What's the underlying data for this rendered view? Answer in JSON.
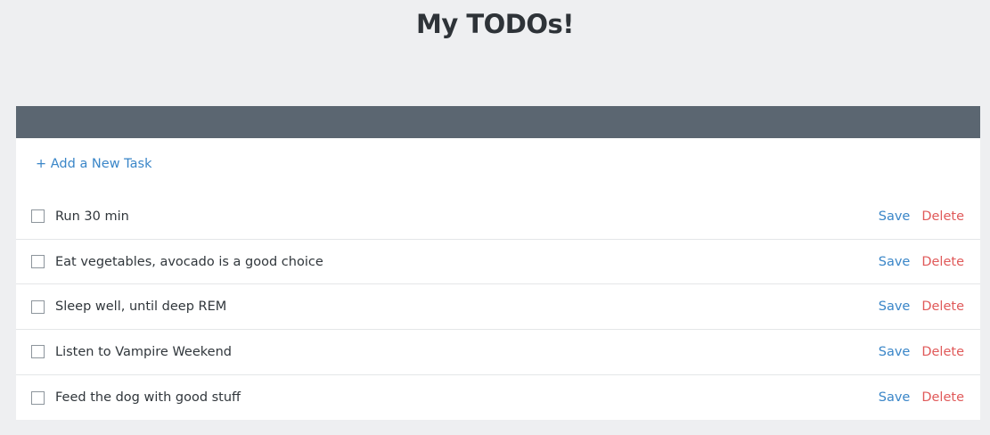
{
  "title": "My TODOs!",
  "add_task_label": "+ Add a New Task",
  "tasks": [
    {
      "text": "Run 30 min",
      "checked": false,
      "save_label": "Save",
      "delete_label": "Delete"
    },
    {
      "text": "Eat vegetables, avocado is a good choice",
      "checked": false,
      "save_label": "Save",
      "delete_label": "Delete"
    },
    {
      "text": "Sleep well, until deep REM",
      "checked": false,
      "save_label": "Save",
      "delete_label": "Delete"
    },
    {
      "text": "Listen to Vampire Weekend",
      "checked": false,
      "save_label": "Save",
      "delete_label": "Delete"
    },
    {
      "text": "Feed the dog with good stuff",
      "checked": false,
      "save_label": "Save",
      "delete_label": "Delete"
    }
  ],
  "colors": {
    "background": "#eeeff1",
    "header_bar": "#5b6671",
    "link_blue": "#3a86c8",
    "delete_red": "#e05a5a"
  }
}
